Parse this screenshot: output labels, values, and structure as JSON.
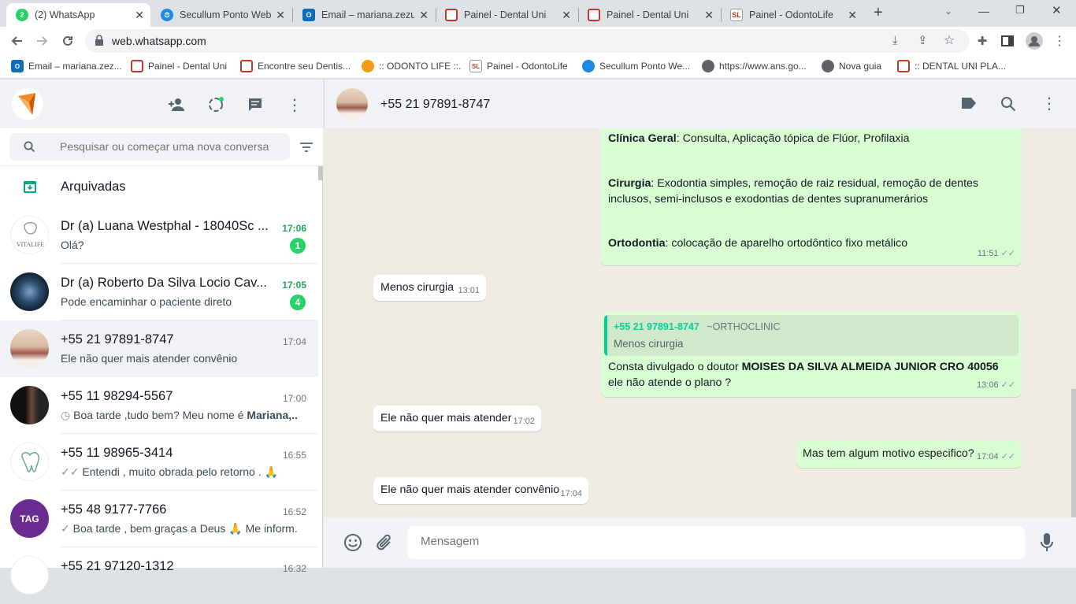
{
  "browser": {
    "tabs": [
      {
        "title": "(2) WhatsApp",
        "favicon": "whatsapp-icon",
        "badge": "2"
      },
      {
        "title": "Secullum Ponto Web -",
        "favicon": "secullum-icon"
      },
      {
        "title": "Email – mariana.zezuir",
        "favicon": "outlook-icon"
      },
      {
        "title": "Painel - Dental Uni",
        "favicon": "dentaluni-icon"
      },
      {
        "title": "Painel - Dental Uni",
        "favicon": "dentaluni-icon"
      },
      {
        "title": "Painel - OdontoLife",
        "favicon": "odontolife-icon"
      }
    ],
    "new_tab": "+",
    "url": "web.whatsapp.com",
    "bookmarks": [
      {
        "label": "Email – mariana.zez...",
        "favicon": "outlook-icon"
      },
      {
        "label": "Painel - Dental Uni",
        "favicon": "dentaluni-icon"
      },
      {
        "label": "Encontre seu Dentis...",
        "favicon": "dentaluni-icon"
      },
      {
        "label": ":: ODONTO LIFE ::.",
        "favicon": "odontolife-icon"
      },
      {
        "label": "Painel - OdontoLife",
        "favicon": "odontolife-icon"
      },
      {
        "label": "Secullum Ponto We...",
        "favicon": "secullum-icon"
      },
      {
        "label": "https://www.ans.go...",
        "favicon": "globe-icon"
      },
      {
        "label": "Nova guia",
        "favicon": "globe-icon"
      },
      {
        "label": ":: DENTAL UNI PLA...",
        "favicon": "dentaluni-icon"
      }
    ]
  },
  "sidebar": {
    "search_placeholder": "Pesquisar ou começar uma nova conversa",
    "archived_label": "Arquivadas",
    "chats": [
      {
        "name": "Dr (a) Luana Westphal - 18040Sc ...",
        "time": "17:06",
        "last": "Olá?",
        "unread": "1",
        "avatar": "vitalife-logo"
      },
      {
        "name": "Dr (a) Roberto Da Silva Locio Cav...",
        "time": "17:05",
        "last": "Pode encaminhar o paciente direto",
        "unread": "4",
        "avatar": "photo"
      },
      {
        "name": "+55 21 97891-8747",
        "time": "17:04",
        "last": "Ele não quer mais atender convênio",
        "selected": true
      },
      {
        "name": "+55 11 98294-5567",
        "time": "17:00",
        "last_prefix": "Boa tarde ,tudo bem? Meu nome é ",
        "last_bold": "Mariana,..."
      },
      {
        "name": "+55 11 98965-3414",
        "time": "16:55",
        "last": "Entendi , muito obrada pelo retorno . 🙏"
      },
      {
        "name": "+55 48 9177-7766",
        "time": "16:52",
        "last": "Boa tarde , bem graças a Deus 🙏 Me inform..."
      },
      {
        "name": "+55 21 97120-1312",
        "time": "16:32",
        "last": ""
      }
    ]
  },
  "conversation": {
    "contact": "+55 21 97891-8747",
    "messages": {
      "m1": {
        "p1_bold": "Clínica Geral",
        "p1": ": Consulta, Aplicação tópica de Flúor, Profilaxia",
        "p2_bold": "Cirurgia",
        "p2": ": Exodontia simples, remoção de raiz residual, remoção de dentes inclusos, semi-inclusos e exodontias de dentes supranumerários",
        "p3_bold": "Ortodontia",
        "p3": ": colocação de aparelho ortodôntico fixo metálico",
        "time": "11:51"
      },
      "m2": {
        "text": "Menos cirurgia",
        "time": "13:01"
      },
      "m3": {
        "quote_author": "+55 21 97891-8747",
        "quote_pushname": "~ORTHOCLINIC",
        "quote_text": "Menos cirurgia",
        "text_a": "Consta divulgado o doutor ",
        "text_bold": "MOISES DA SILVA ALMEIDA JUNIOR CRO 40056",
        "text_b": " ele não atende o plano ?",
        "time": "13:06"
      },
      "m4": {
        "text": "Ele não quer mais atender",
        "time": "17:02"
      },
      "m5": {
        "text": "Mas tem algum motivo especifico?",
        "time": "17:04"
      },
      "m6": {
        "text": "Ele não quer mais atender convênio",
        "time": "17:04"
      }
    },
    "input_placeholder": "Mensagem"
  },
  "colors": {
    "accent": "#25d366",
    "outgoing": "#d9fdd3",
    "quote_bar": "#06cf9c"
  }
}
